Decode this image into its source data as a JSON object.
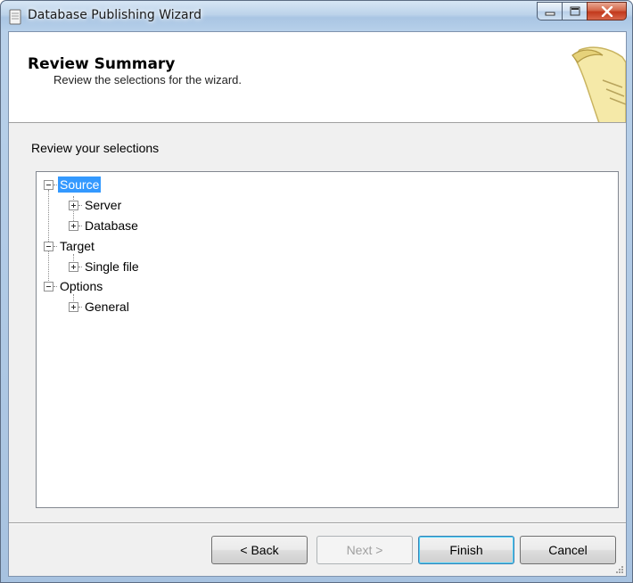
{
  "window": {
    "title": "Database Publishing Wizard"
  },
  "header": {
    "title": "Review Summary",
    "subtitle": "Review the selections for the wizard."
  },
  "main": {
    "section_label": "Review your selections",
    "tree": {
      "source": {
        "label": "Source",
        "selected": true,
        "expanded": true
      },
      "server": {
        "label": "Server",
        "expanded": false
      },
      "database": {
        "label": "Database",
        "expanded": false
      },
      "target": {
        "label": "Target",
        "expanded": true
      },
      "single_file": {
        "label": "Single file",
        "expanded": false
      },
      "options": {
        "label": "Options",
        "expanded": true
      },
      "general": {
        "label": "General",
        "expanded": false
      }
    }
  },
  "footer": {
    "back_label": "< Back",
    "next_label": "Next >",
    "finish_label": "Finish",
    "cancel_label": "Cancel"
  },
  "colors": {
    "selection": "#3399ff",
    "close_button": "#c2391c",
    "frame": "#a7c2e0"
  }
}
